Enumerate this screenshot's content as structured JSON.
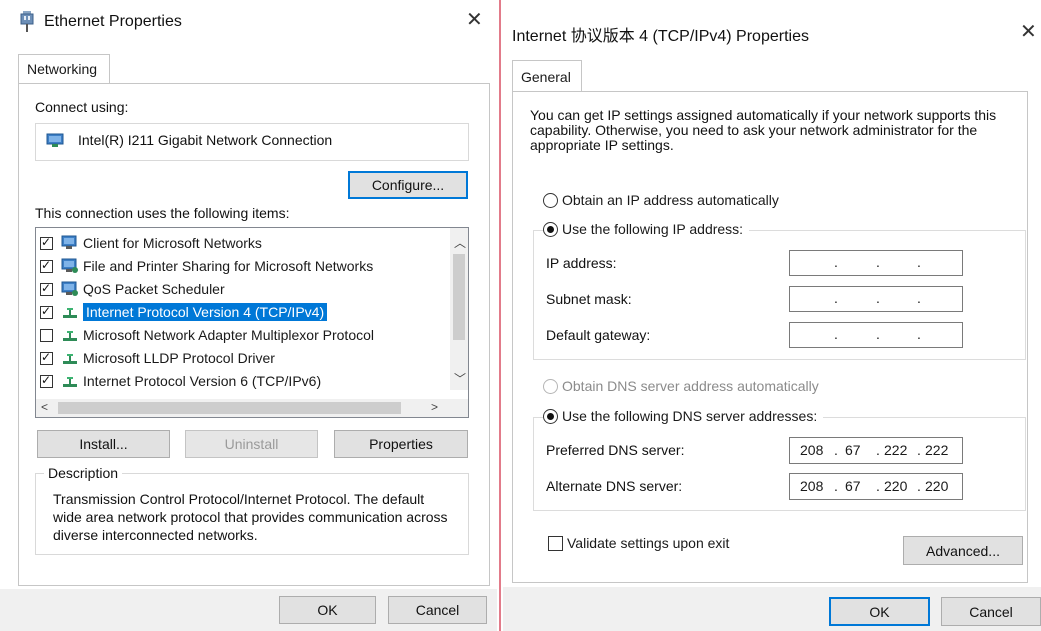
{
  "left": {
    "title": "Ethernet Properties",
    "tab": "Networking",
    "connect_using_label": "Connect using:",
    "adapter_name": "Intel(R) I211 Gigabit Network Connection",
    "configure_label": "Configure...",
    "items_label": "This connection uses the following items:",
    "items": [
      {
        "label": "Client for Microsoft Networks",
        "checked": true,
        "icon": "network-client-icon"
      },
      {
        "label": "File and Printer Sharing for Microsoft Networks",
        "checked": true,
        "icon": "network-service-icon"
      },
      {
        "label": "QoS Packet Scheduler",
        "checked": true,
        "icon": "network-service-icon"
      },
      {
        "label": "Internet Protocol Version 4 (TCP/IPv4)",
        "checked": true,
        "icon": "protocol-icon",
        "selected": true
      },
      {
        "label": "Microsoft Network Adapter Multiplexor Protocol",
        "checked": false,
        "icon": "protocol-icon"
      },
      {
        "label": "Microsoft LLDP Protocol Driver",
        "checked": true,
        "icon": "protocol-icon"
      },
      {
        "label": "Internet Protocol Version 6 (TCP/IPv6)",
        "checked": true,
        "icon": "protocol-icon"
      }
    ],
    "install_label": "Install...",
    "uninstall_label": "Uninstall",
    "properties_label": "Properties",
    "description_label": "Description",
    "description_text": "Transmission Control Protocol/Internet Protocol. The default wide area network protocol that provides communication across diverse interconnected networks.",
    "ok_label": "OK",
    "cancel_label": "Cancel"
  },
  "right": {
    "title": "Internet 协议版本 4 (TCP/IPv4) Properties",
    "tab": "General",
    "intro_text": "You can get IP settings assigned automatically if your network supports this capability. Otherwise, you need to ask your network administrator for the appropriate IP settings.",
    "obtain_ip_label": "Obtain an IP address automatically",
    "use_ip_label": "Use the following IP address:",
    "ip_address_label": "IP address:",
    "subnet_mask_label": "Subnet mask:",
    "gateway_label": "Default gateway:",
    "ip_address_value": [
      "",
      "",
      "",
      ""
    ],
    "obtain_dns_label": "Obtain DNS server address automatically",
    "use_dns_label": "Use the following DNS server addresses:",
    "preferred_dns_label": "Preferred DNS server:",
    "alternate_dns_label": "Alternate DNS server:",
    "preferred_dns": [
      "208",
      "67",
      "222",
      "222"
    ],
    "alternate_dns": [
      "208",
      "67",
      "220",
      "220"
    ],
    "validate_label": "Validate settings upon exit",
    "validate_checked": false,
    "advanced_label": "Advanced...",
    "ok_label": "OK",
    "cancel_label": "Cancel",
    "selected_ip_mode": "manual",
    "selected_dns_mode": "manual"
  },
  "colors": {
    "accent": "#0078d7",
    "divider": "#e27b8a"
  }
}
